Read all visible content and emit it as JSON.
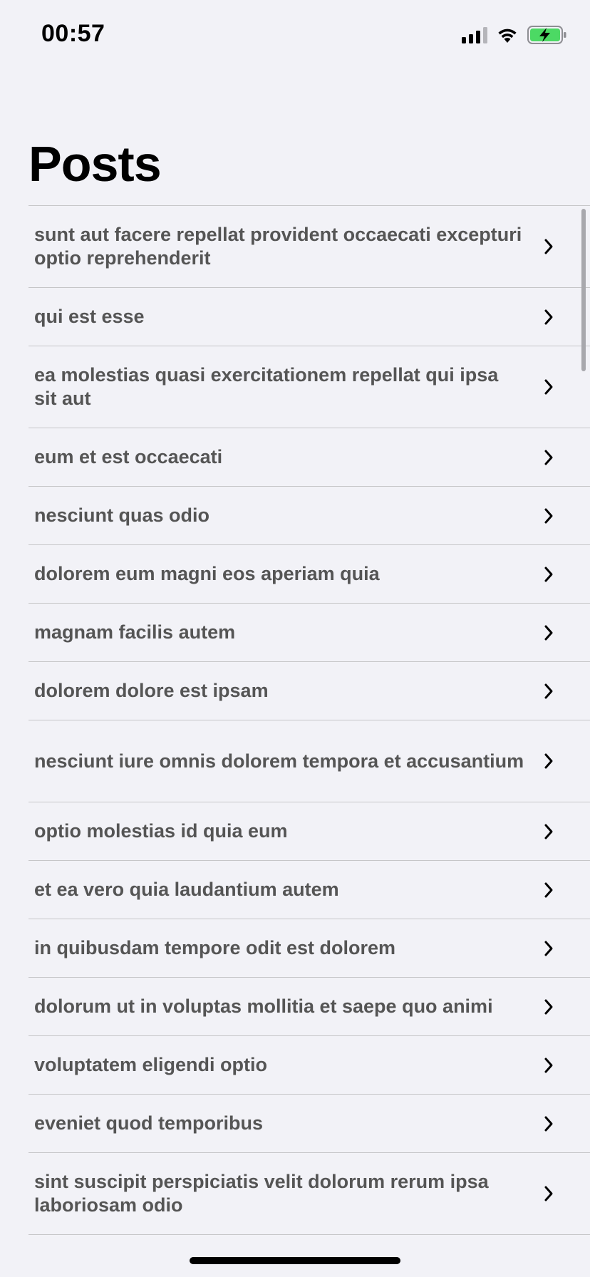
{
  "status_bar": {
    "time": "00:57",
    "signal_icon": "cellular-signal-icon",
    "wifi_icon": "wifi-icon",
    "battery_icon": "battery-charging-icon",
    "battery_color": "#4cd964"
  },
  "navigation": {
    "title": "Posts"
  },
  "posts": [
    {
      "title": "sunt aut facere repellat provident occaecati excepturi optio reprehenderit"
    },
    {
      "title": "qui est esse"
    },
    {
      "title": "ea molestias quasi exercitationem repellat qui ipsa sit aut"
    },
    {
      "title": "eum et est occaecati"
    },
    {
      "title": "nesciunt quas odio"
    },
    {
      "title": "dolorem eum magni eos aperiam quia"
    },
    {
      "title": "magnam facilis autem"
    },
    {
      "title": "dolorem dolore est ipsam"
    },
    {
      "title": "nesciunt iure omnis dolorem tempora et accusantium"
    },
    {
      "title": "optio molestias id quia eum"
    },
    {
      "title": "et ea vero quia laudantium autem"
    },
    {
      "title": "in quibusdam tempore odit est dolorem"
    },
    {
      "title": "dolorum ut in voluptas mollitia et saepe quo animi"
    },
    {
      "title": "voluptatem eligendi optio"
    },
    {
      "title": "eveniet quod temporibus"
    },
    {
      "title": "sint suscipit perspiciatis velit dolorum rerum ipsa laboriosam odio"
    }
  ],
  "row_accessory_icon": "chevron-right-icon"
}
